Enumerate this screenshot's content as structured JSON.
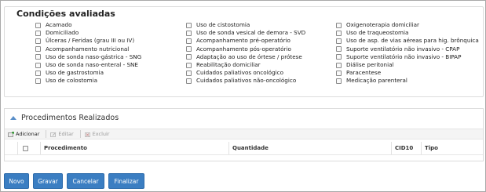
{
  "conditions": {
    "title": "Condições avaliadas",
    "col1": [
      "Acamado",
      "Domiciliado",
      "Úlceras / Feridas (grau III ou IV)",
      "Acompanhamento nutricional",
      "Uso de sonda naso-gástrica - SNG",
      "Uso de sonda naso-enteral - SNE",
      "Uso de gastrostomia",
      "Uso de colostomia"
    ],
    "col2": [
      "Uso de cistostomia",
      "Uso de sonda vesical de demora - SVD",
      "Acompanhamento pré-operatório",
      "Acompanhamento pós-operatório",
      "Adaptação ao uso de órtese / prótese",
      "Reabilitação domiciliar",
      "Cuidados paliativos oncológico",
      "Cuidados paliativos não-oncológico"
    ],
    "col3": [
      "Oxigenoterapia domiciliar",
      "Uso de traqueostomia",
      "Uso de asp. de vias aéreas para hig. brônquica",
      "Suporte ventilatório não invasivo - CPAP",
      "Suporte ventilatório não invasivo - BIPAP",
      "Diálise peritonial",
      "Paracentese",
      "Medicação parenteral"
    ]
  },
  "procedures": {
    "title": "Procedimentos Realizados",
    "toolbar": {
      "add": "Adicionar",
      "edit": "Editar",
      "delete": "Excluir"
    },
    "columns": {
      "procedure": "Procedimento",
      "quantity": "Quantidade",
      "cid10": "CID10",
      "type": "Tipo"
    }
  },
  "actions": {
    "new": "Novo",
    "save": "Gravar",
    "cancel": "Cancelar",
    "finish": "Finalizar"
  },
  "colors": {
    "button_bg": "#3b7ec2",
    "accent_triangle": "#5a8fc9"
  }
}
